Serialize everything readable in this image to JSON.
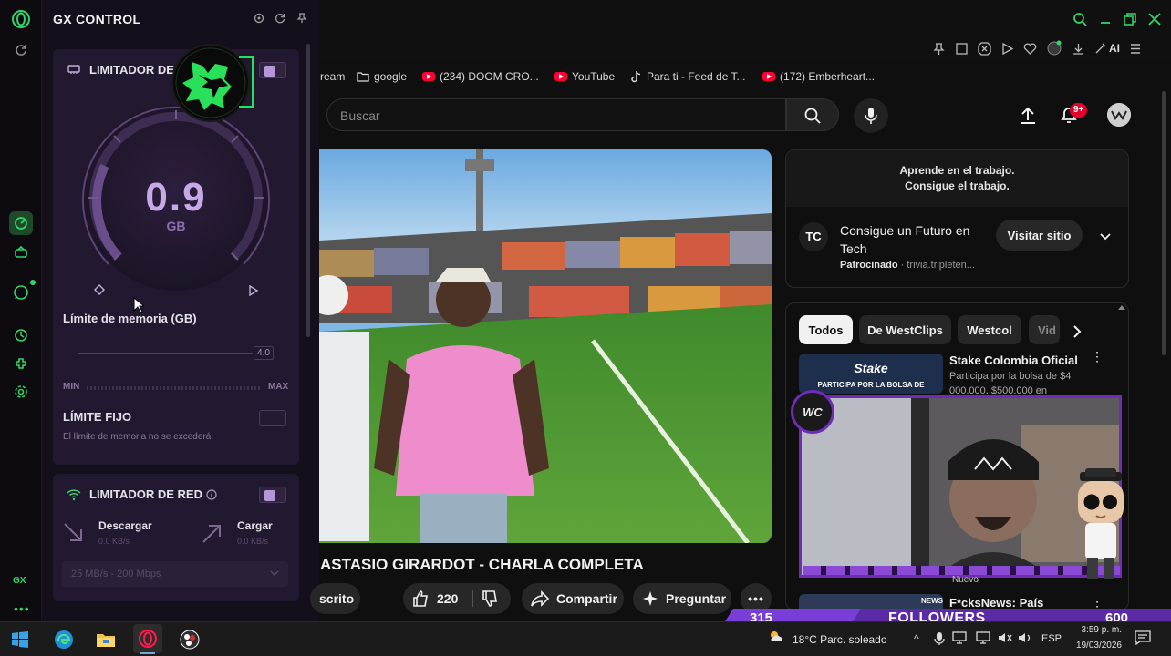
{
  "gx": {
    "title": "GX CONTROL",
    "ram": {
      "title": "LIMITADOR DE",
      "value": "0.9",
      "unit": "GB",
      "limit_label": "Límite de memoria (GB)",
      "slider_value": "4.0",
      "min": "MIN",
      "max": "MAX",
      "hard_limit": "LÍMITE FIJO",
      "hard_limit_desc": "El límite de memoria no se excederá."
    },
    "net": {
      "title": "LIMITADOR DE RED",
      "download": "Descargar",
      "download_val": "0.0 KB/s",
      "upload": "Cargar",
      "upload_val": "0.0 KB/s",
      "select": "25 MB/s - 200 Mbps"
    },
    "rail_footer": "GX"
  },
  "bookmarks": [
    {
      "label": "ream",
      "icon": "none"
    },
    {
      "label": "google",
      "icon": "folder-icon"
    },
    {
      "label": "(234) DOOM CRO...",
      "icon": "youtube-icon"
    },
    {
      "label": "YouTube",
      "icon": "youtube-icon"
    },
    {
      "label": "Para ti - Feed de T...",
      "icon": "tiktok-icon"
    },
    {
      "label": "(172) Emberheart...",
      "icon": "youtube-icon"
    }
  ],
  "toolbar": {
    "ai_label": "AI"
  },
  "youtube": {
    "search_placeholder": "Buscar",
    "notif_badge": "9+",
    "video_title": "ASTASIO GIRARDOT - CHARLA COMPLETA",
    "subscribed": "scrito",
    "likes": "220",
    "share": "Compartir",
    "ask": "Preguntar",
    "ad": {
      "banner_line1": "Aprende en el trabajo.",
      "banner_line2": "Consigue el trabajo.",
      "logo": "TC",
      "title": "Consigue un Futuro en Tech",
      "sponsored": "Patrocinado",
      "domain": "· trivia.tripleten...",
      "visit": "Visitar sitio"
    },
    "chips": [
      "Todos",
      "De WestClips",
      "Westcol",
      "Vid"
    ],
    "recs": [
      {
        "title": "Stake Colombia Oficial",
        "desc": "Participa por la bolsa de $4",
        "desc2": "000.000, $500.000 en",
        "thumb_text": "Stake",
        "thumb_sub": "PARTICIPA POR LA BOLSA DE"
      },
      {
        "title": "F*cksNews: País",
        "badge": "Nuevo",
        "thumb_text": "NEWS"
      }
    ]
  },
  "stream": {
    "followers_label": "FOLLOWERS",
    "current": "315",
    "goal": "600",
    "avatar_text": "WC"
  },
  "taskbar": {
    "weather": "18°C  Parc. soleado",
    "lang": "ESP",
    "time": "3:59 p. m.",
    "date": "19/03/2026"
  }
}
